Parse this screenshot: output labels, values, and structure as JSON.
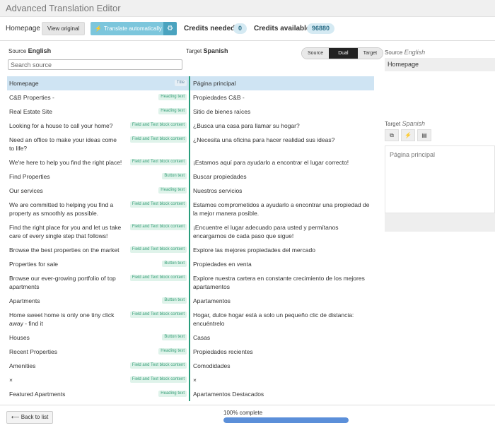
{
  "app": {
    "title": "Advanced Translation Editor"
  },
  "toolbar": {
    "page_name": "Homepage",
    "view_original_label": "View original",
    "translate_label": "Translate automatically",
    "credits_needed_label": "Credits needed",
    "credits_needed_value": "0",
    "credits_available_label": "Credits available",
    "credits_available_value": "96880"
  },
  "editor": {
    "source_label": "Source",
    "source_lang": "English",
    "target_label": "Target",
    "target_lang": "Spanish",
    "search_placeholder": "Search source",
    "view_modes": [
      "Source",
      "Dual",
      "Target"
    ],
    "active_view_mode": "Dual"
  },
  "rows": [
    {
      "source": "Homepage",
      "type": "Title",
      "target": "Página principal",
      "selected": true
    },
    {
      "source": "C&B Properties -",
      "type": "Heading text",
      "target": "Propiedades C&B -"
    },
    {
      "source": "Real Estate Site",
      "type": "Heading text",
      "target": "Sitio de bienes raíces"
    },
    {
      "source": "Looking for a house to call your home?",
      "type": "Field and Text block content",
      "target": "¿Busca una casa para llamar su hogar?"
    },
    {
      "source": "Need an office to make your ideas come to life?",
      "type": "Field and Text block content",
      "target": "¿Necesita una oficina para hacer realidad sus ideas?"
    },
    {
      "source": "We're here to help you find the right place!",
      "type": "Field and Text block content",
      "target": "¡Estamos aquí para ayudarlo a encontrar el lugar correcto!"
    },
    {
      "source": "Find Properties",
      "type": "Button text",
      "target": "Buscar propiedades"
    },
    {
      "source": "Our services",
      "type": "Heading text",
      "target": "Nuestros servicios"
    },
    {
      "source": "We are committed to helping you find a property as smoothly as possible.",
      "type": "Field and Text block content",
      "target": "Estamos comprometidos a ayudarlo a encontrar una propiedad de la mejor manera posible."
    },
    {
      "source": "Find the right place for you and let us take care of every single step that follows!",
      "type": "Field and Text block content",
      "target": "¡Encuentre el lugar adecuado para usted y permítanos encargarnos de cada paso que sigue!"
    },
    {
      "source": "Browse the best properties on the market",
      "type": "Field and Text block content",
      "target": "Explore las mejores propiedades del mercado"
    },
    {
      "source": "Properties for sale",
      "type": "Button text",
      "target": "Propiedades en venta"
    },
    {
      "source": "Browse our ever-growing portfolio of top apartments",
      "type": "Field and Text block content",
      "target": "Explore nuestra cartera en constante crecimiento de los mejores apartamentos"
    },
    {
      "source": "Apartments",
      "type": "Button text",
      "target": "Apartamentos"
    },
    {
      "source": "Home sweet home is only one tiny click away - find it",
      "type": "Field and Text block content",
      "target": "Hogar, dulce hogar está a solo un pequeño clic de distancia: encuéntrelo"
    },
    {
      "source": "Houses",
      "type": "Button text",
      "target": "Casas"
    },
    {
      "source": "Recent Properties",
      "type": "Heading text",
      "target": "Propiedades recientes"
    },
    {
      "source": "Amenities",
      "type": "Field and Text block content",
      "target": "Comodidades"
    },
    {
      "source": "×",
      "type": "Field and Text block content",
      "target": "×"
    },
    {
      "source": "Featured Apartments",
      "type": "Heading text",
      "target": "Apartamentos Destacados"
    }
  ],
  "side_panel": {
    "source_label": "Source",
    "source_lang": "English",
    "source_text": "Homepage",
    "target_label": "Target",
    "target_lang": "Spanish",
    "target_text": "Página principal",
    "tool_icons": [
      "copy-icon",
      "bolt-icon",
      "book-icon"
    ]
  },
  "footer": {
    "back_label": "⟵ Back to list",
    "progress_label": "100% complete",
    "progress_fraction": 1.0
  },
  "colors": {
    "accent_teal": "#2a9d7c",
    "translate_button": "#7cc6dc",
    "progress_fill": "#5b8fd9",
    "selected_row": "#cfe4f3"
  }
}
